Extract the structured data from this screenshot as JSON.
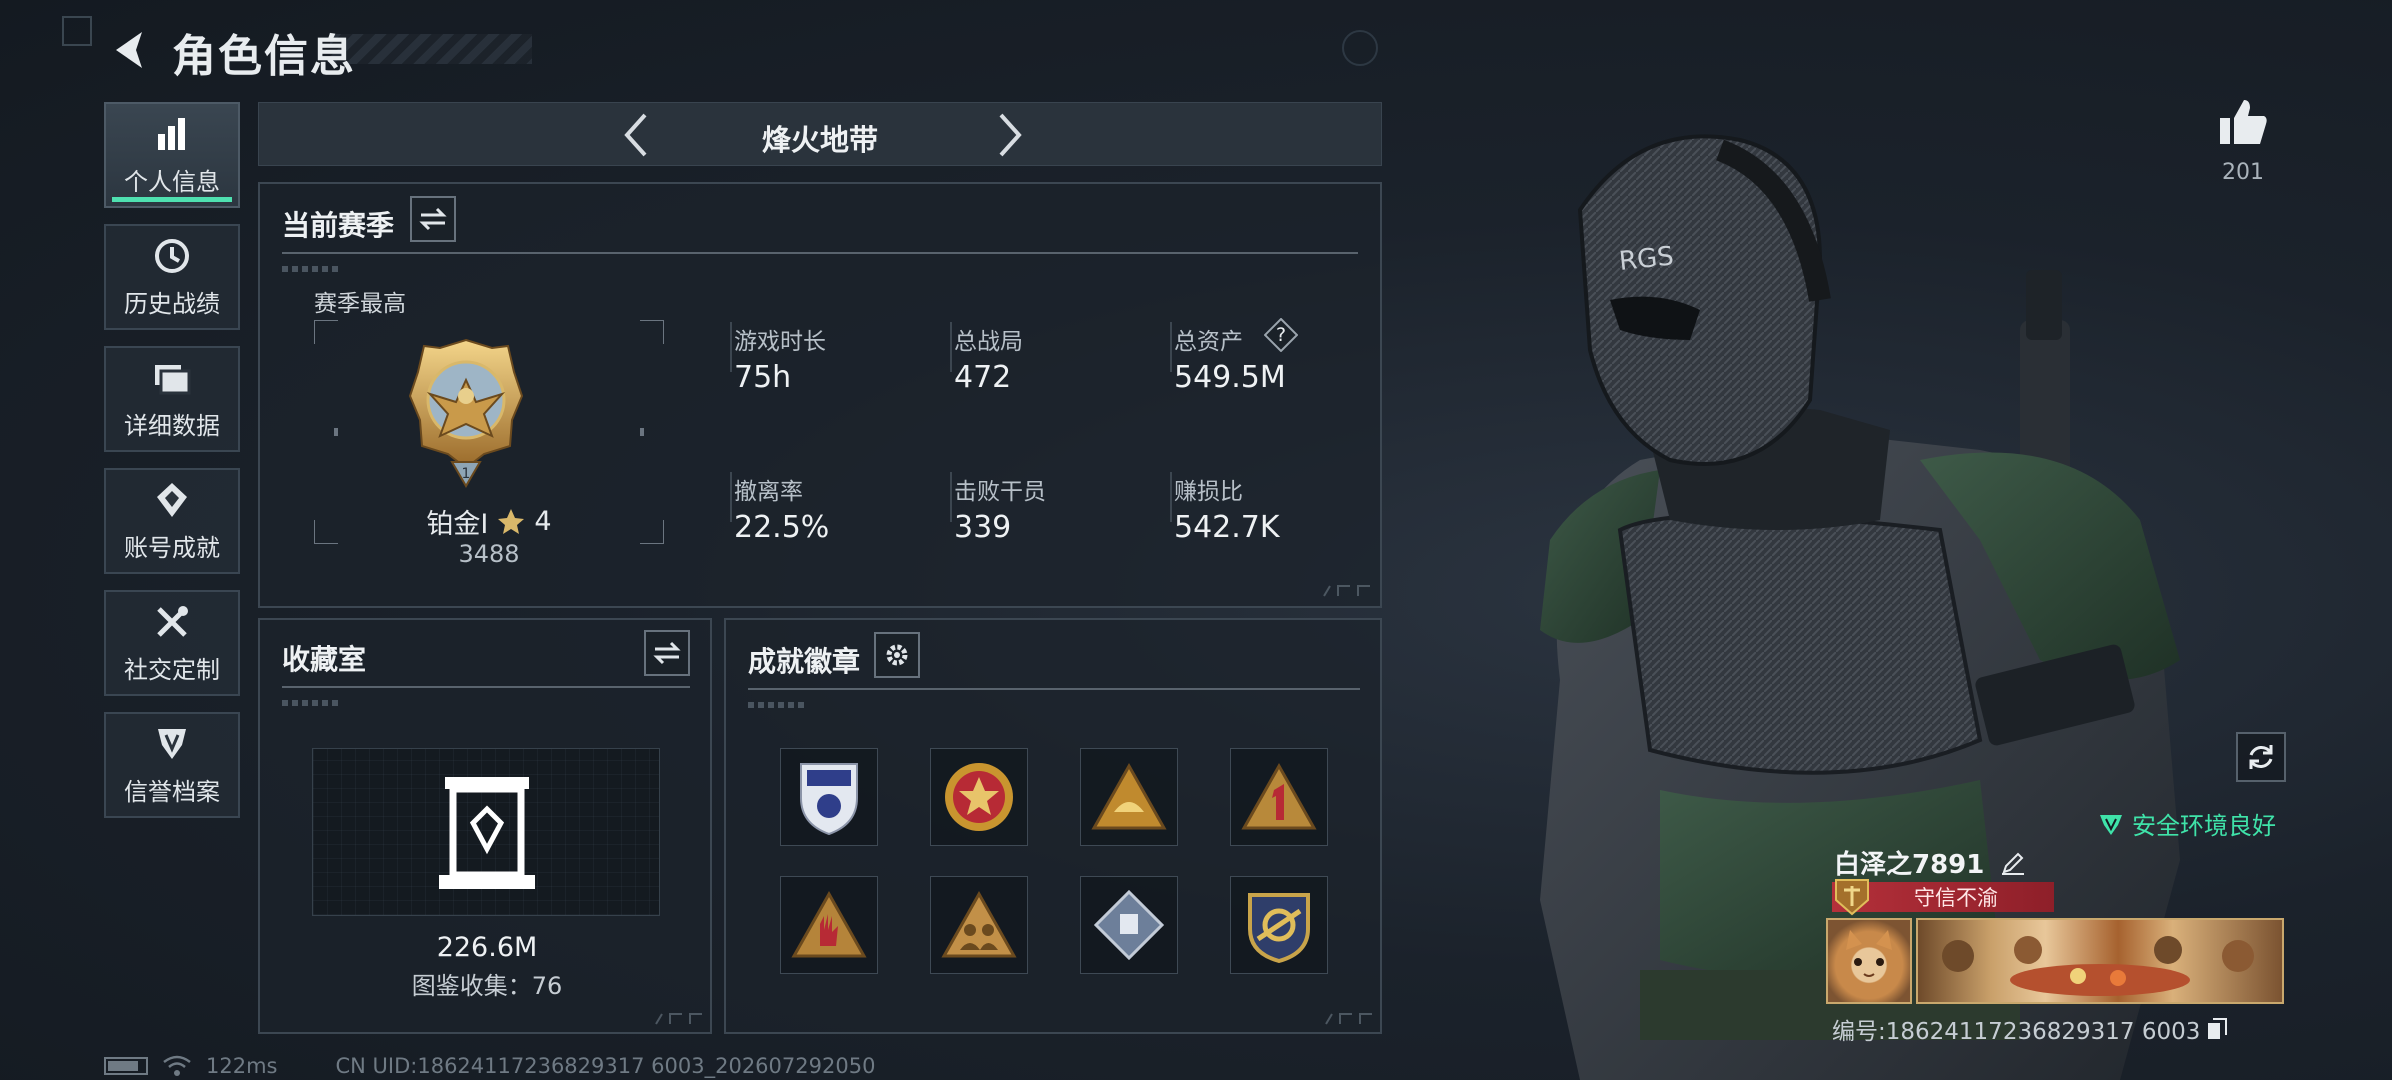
{
  "header": {
    "title": "角色信息"
  },
  "sidebar": {
    "items": [
      {
        "label": "个人信息",
        "icon": "bar-chart-icon",
        "active": true
      },
      {
        "label": "历史战绩",
        "icon": "history-icon"
      },
      {
        "label": "详细数据",
        "icon": "folder-icon"
      },
      {
        "label": "账号成就",
        "icon": "achievement-icon"
      },
      {
        "label": "社交定制",
        "icon": "wrench-icon"
      },
      {
        "label": "信誉档案",
        "icon": "shield-icon"
      }
    ]
  },
  "mode_bar": {
    "title": "烽火地带"
  },
  "season": {
    "title": "当前赛季",
    "best_label": "赛季最高",
    "rank_name": "铂金I",
    "rank_stars": "4",
    "rank_points": "3488",
    "stats": [
      {
        "label": "游戏时长",
        "value": "75h"
      },
      {
        "label": "总战局",
        "value": "472"
      },
      {
        "label": "总资产",
        "value": "549.5M",
        "help": "?"
      },
      {
        "label": "撤离率",
        "value": "22.5%"
      },
      {
        "label": "击败干员",
        "value": "339"
      },
      {
        "label": "赚损比",
        "value": "542.7K"
      }
    ]
  },
  "collection": {
    "title": "收藏室",
    "value": "226.6M",
    "catalog_label": "图鉴收集：76"
  },
  "badges": {
    "title": "成就徽章",
    "items": [
      "shield-badge",
      "star-medal",
      "cake-badge",
      "number-one-badge",
      "hand-badge",
      "group-badge",
      "diamond-badge",
      "crest-badge"
    ]
  },
  "profile": {
    "likes": "201",
    "safety_status": "安全环境良好",
    "name": "白泽之7891",
    "title_tag": "守信不渝",
    "id_text": "编号:18624117236829317 6003"
  },
  "status_bar": {
    "ping": "122ms",
    "uid": "CN UID:18624117236829317 6003_202607292050"
  },
  "colors": {
    "accent": "#4fe0b0",
    "safe": "#3fe3a9",
    "tag_red": "#b4303a"
  }
}
